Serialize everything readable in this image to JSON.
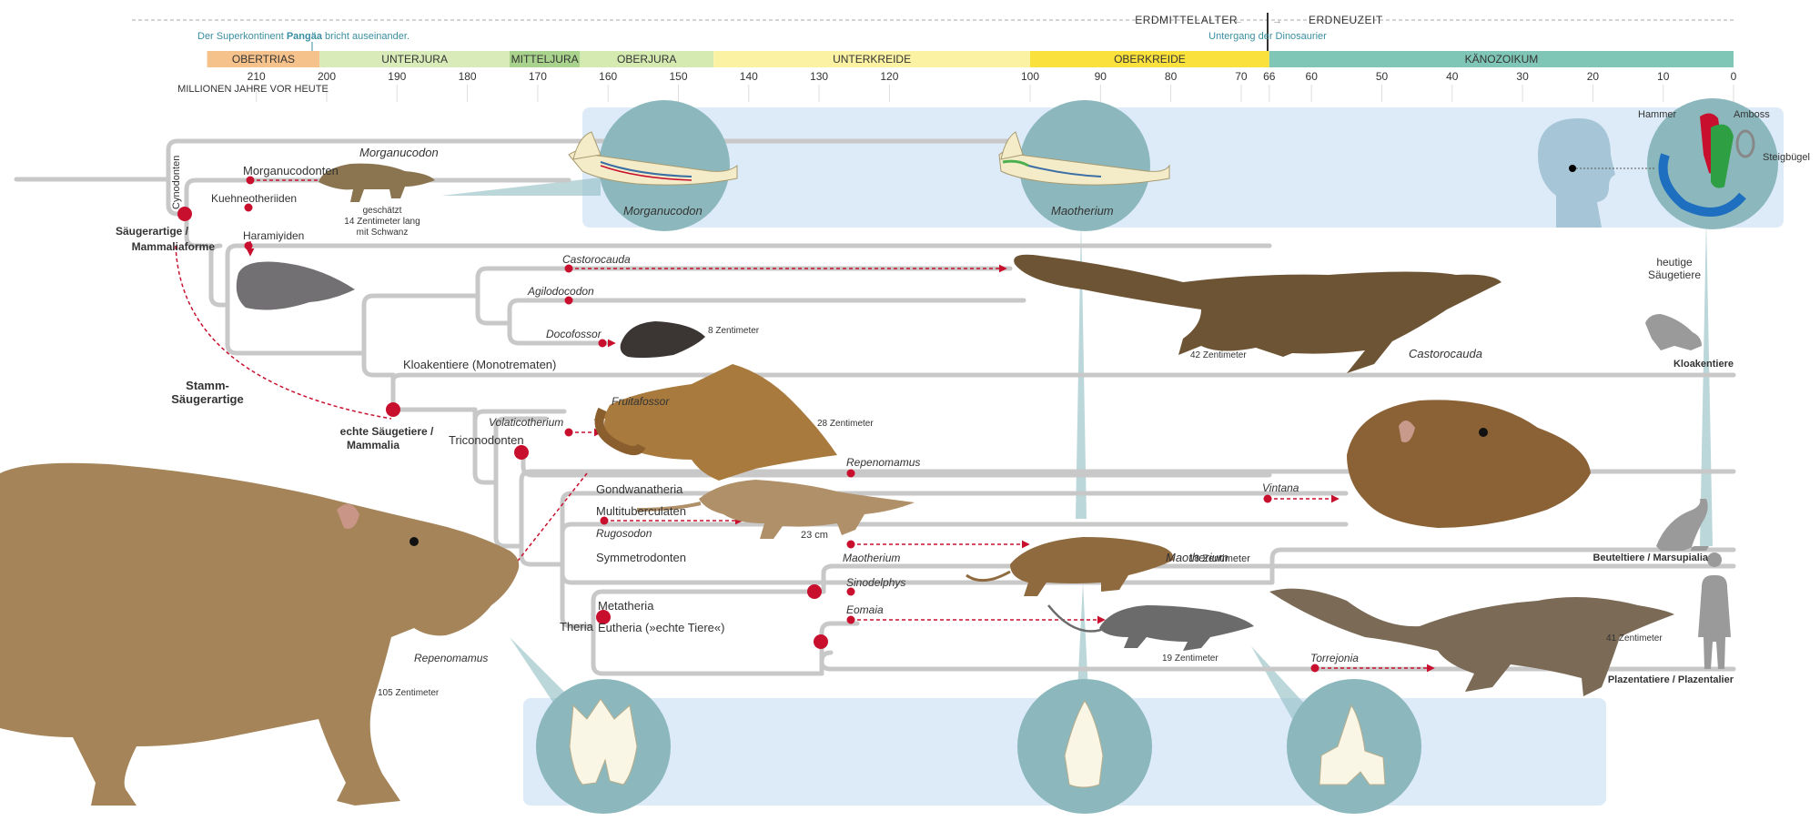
{
  "header": {
    "pangaea_prefix": "Der Superkontinent ",
    "pangaea_bold": "Pangäa",
    "pangaea_suffix": " bricht auseinander.",
    "erdmittelalter": "ERDMITTELALTER",
    "erdneuzeit": "ERDNEUZEIT",
    "dino_extinction": "Untergang der Dinosaurier",
    "axis_unit": "MILLIONEN JAHRE VOR HEUTE"
  },
  "periods": [
    {
      "label": "OBERTRIAS",
      "start": 217,
      "end": 201,
      "color": "#f6c28b"
    },
    {
      "label": "UNTERJURA",
      "start": 201,
      "end": 174,
      "color": "#d9ebb9"
    },
    {
      "label": "MITTELJURA",
      "start": 174,
      "end": 164,
      "color": "#a9d38d"
    },
    {
      "label": "OBERJURA",
      "start": 164,
      "end": 145,
      "color": "#d5eab0"
    },
    {
      "label": "UNTERKREIDE",
      "start": 145,
      "end": 100,
      "color": "#fbf3a3"
    },
    {
      "label": "OBERKREIDE",
      "start": 100,
      "end": 66,
      "color": "#fbe13c"
    },
    {
      "label": "KÄNOZOIKUM",
      "start": 66,
      "end": 0,
      "color": "#7fc6b6"
    }
  ],
  "ticks": [
    "210",
    "200",
    "190",
    "180",
    "170",
    "160",
    "150",
    "140",
    "130",
    "120",
    "100",
    "90",
    "80",
    "70",
    "66",
    "60",
    "50",
    "40",
    "30",
    "20",
    "10",
    "0"
  ],
  "clade_labels": {
    "cynodonten": "Cynodonten",
    "saeugerartige_1": "Säugerartige /",
    "saeugerartige_2": "Mammaliaforme",
    "stamm_1": "Stamm-",
    "stamm_2": "Säugerartige",
    "echte_1": "echte Säugetiere /",
    "echte_2": "Mammalia",
    "morganucodonten": "Morganucodonten",
    "kuehneotheriiden": "Kuehneotheriiden",
    "haramiyiden": "Haramiyiden",
    "kloakentiere": "Kloakentiere (Monotrematen)",
    "triconodonten": "Triconodonten",
    "gondwanatheria": "Gondwanatheria",
    "multituberculaten": "Multituberculaten",
    "symmetrodonten": "Symmetrodonten",
    "theria": "Theria",
    "metatheria": "Metatheria",
    "eutheria": "Eutheria (»echte Tiere«)"
  },
  "taxa": {
    "morganucodon": "Morganucodon",
    "castorocauda": "Castorocauda",
    "agilodocodon": "Agilodocodon",
    "docofossor": "Docofossor",
    "fruitafossor": "Fruitafossor",
    "volaticotherium": "Volaticotherium",
    "repenomamus": "Repenomamus",
    "vintana": "Vintana",
    "rugosodon": "Rugosodon",
    "maotherium": "Maotherium",
    "sinodelphys": "Sinodelphys",
    "eomaia": "Eomaia",
    "torrejonia": "Torrejonia"
  },
  "sizes": {
    "morganucodon_1": "geschätzt",
    "morganucodon_2": "14 Zentimeter lang",
    "morganucodon_3": "mit Schwanz",
    "docofossor": "8 Zentimeter",
    "castorocauda": "42 Zentimeter",
    "volaticotherium": "28 Zentimeter",
    "rugosodon": "23 cm",
    "maotherium": "18 Zentimeter",
    "eomaia": "19 Zentimeter",
    "torrejonia": "41 Zentimeter",
    "repenomamus": "105 Zentimeter"
  },
  "extant": {
    "heutige_1": "heutige",
    "heutige_2": "Säugetiere",
    "kloakentiere": "Kloakentiere",
    "beuteltiere": "Beuteltiere / Marsupialia",
    "plazentatiere": "Plazentatiere / Plazentalier"
  },
  "ear": {
    "hammer": "Hammer",
    "amboss": "Amboss",
    "steigbuegel": "Steigbügel"
  },
  "colors": {
    "branch": "#c8c8c8",
    "node": "#c8102e",
    "teal": "#5c9ea4",
    "panel": "#dcebf7"
  }
}
